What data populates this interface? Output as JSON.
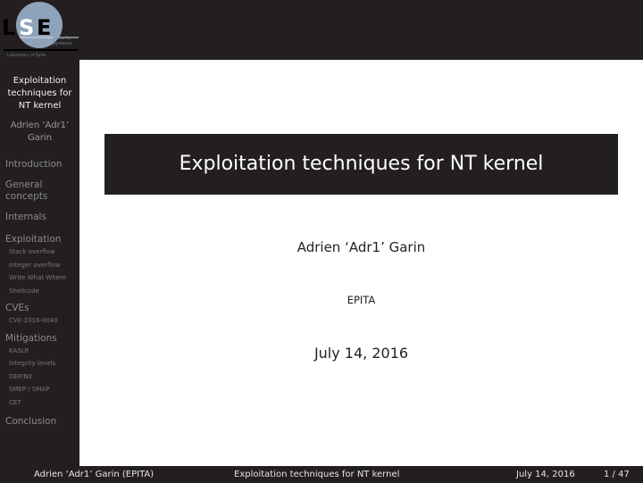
{
  "logo": {
    "letters": [
      "L",
      "S",
      "E"
    ],
    "tagline_lines": [
      "Security",
      "Systems"
    ],
    "subtitle": "Laboratory of Epita",
    "circle_color": "#8ea3ba"
  },
  "sidebar": {
    "title": "Exploitation techniques for NT kernel",
    "title_lines": [
      "Exploitation",
      "techniques for",
      "NT kernel"
    ],
    "author_lines": [
      "Adrien ‘Adr1’",
      "Garin"
    ],
    "sections": [
      {
        "label": "Introduction",
        "items": []
      },
      {
        "label_lines": [
          "General",
          "concepts"
        ],
        "items": []
      },
      {
        "label": "Internals",
        "items": []
      },
      {
        "label": "Exploitation",
        "items": [
          "Stack overflow",
          "Integer overflow",
          "Write What Where",
          "Shellcode"
        ]
      },
      {
        "label": "CVEs",
        "items": [
          "CVE-2016-0040"
        ]
      },
      {
        "label": "Mitigations",
        "items": [
          "KASLR",
          "Integrity levels",
          "DEP/NX",
          "SMEP / SMAP",
          "CET"
        ]
      },
      {
        "label": "Conclusion",
        "items": []
      }
    ]
  },
  "slide": {
    "title": "Exploitation techniques for NT kernel",
    "author": "Adrien ‘Adr1’ Garin",
    "institute": "EPITA",
    "date": "July 14, 2016"
  },
  "footer": {
    "author": "Adrien ‘Adr1’ Garin  (EPITA)",
    "title": "Exploitation techniques for NT kernel",
    "date": "July 14, 2016",
    "page": "1 / 47"
  },
  "colors": {
    "dark": "#231f20",
    "sidebar_text": "#8a8a8a"
  }
}
